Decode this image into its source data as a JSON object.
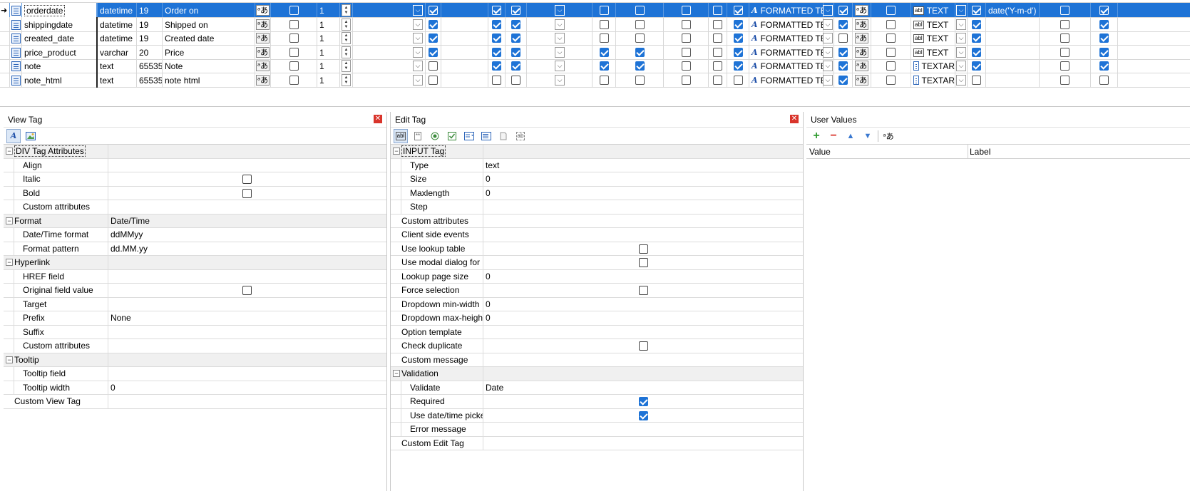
{
  "grid": {
    "rows": [
      {
        "name": "orderdate",
        "type": "datetime",
        "size": "19",
        "caption": "Order on",
        "sort": "1",
        "c1": true,
        "c2": true,
        "c3": true,
        "c4": false,
        "c5": false,
        "c6": false,
        "c7": false,
        "c8": true,
        "edit_tag": "FORMATTED TE",
        "c9": true,
        "c10": false,
        "view_tag": "TEXT",
        "c11": true,
        "default": "date('Y-m-d')",
        "c12": false,
        "c13": true,
        "selected": true
      },
      {
        "name": "shippingdate",
        "type": "datetime",
        "size": "19",
        "caption": "Shipped on",
        "sort": "1",
        "c1": true,
        "c2": true,
        "c3": true,
        "c4": false,
        "c5": false,
        "c6": false,
        "c7": false,
        "c8": true,
        "edit_tag": "FORMATTED TE",
        "c9": true,
        "c10": false,
        "view_tag": "TEXT",
        "c11": true,
        "default": "",
        "c12": false,
        "c13": true,
        "selected": false
      },
      {
        "name": "created_date",
        "type": "datetime",
        "size": "19",
        "caption": "Created date",
        "sort": "1",
        "c1": true,
        "c2": true,
        "c3": true,
        "c4": false,
        "c5": false,
        "c6": false,
        "c7": false,
        "c8": true,
        "edit_tag": "FORMATTED TE",
        "c9": false,
        "c10": false,
        "view_tag": "TEXT",
        "c11": true,
        "default": "",
        "c12": false,
        "c13": true,
        "selected": false
      },
      {
        "name": "price_product",
        "type": "varchar",
        "size": "20",
        "caption": "Price",
        "sort": "1",
        "c1": true,
        "c2": true,
        "c3": true,
        "c4": true,
        "c5": true,
        "c6": false,
        "c7": false,
        "c8": true,
        "edit_tag": "FORMATTED TE",
        "c9": true,
        "c10": false,
        "view_tag": "TEXT",
        "c11": true,
        "default": "",
        "c12": false,
        "c13": true,
        "selected": false
      },
      {
        "name": "note",
        "type": "text",
        "size": "65535",
        "caption": "Note",
        "sort": "1",
        "c1": false,
        "c2": true,
        "c3": true,
        "c4": true,
        "c5": true,
        "c6": false,
        "c7": false,
        "c8": true,
        "edit_tag": "FORMATTED TE",
        "c9": true,
        "c10": false,
        "view_tag": "TEXTAR",
        "c11": true,
        "default": "",
        "c12": false,
        "c13": true,
        "selected": false
      },
      {
        "name": "note_html",
        "type": "text",
        "size": "65535",
        "caption": "note html",
        "sort": "1",
        "c1": false,
        "c2": false,
        "c3": false,
        "c4": false,
        "c5": false,
        "c6": false,
        "c7": false,
        "c8": false,
        "edit_tag": "FORMATTED TE",
        "c9": true,
        "c10": false,
        "view_tag": "TEXTAR",
        "c11": false,
        "default": "",
        "c12": false,
        "c13": false,
        "selected": false
      }
    ]
  },
  "view_tag_panel": {
    "title": "View Tag",
    "rows": [
      {
        "kind": "cat",
        "name": "DIV Tag Attributes",
        "value": "",
        "focus": true
      },
      {
        "kind": "prop",
        "name": "Align",
        "value": ""
      },
      {
        "kind": "prop",
        "name": "Italic",
        "value": "",
        "check": false
      },
      {
        "kind": "prop",
        "name": "Bold",
        "value": "",
        "check": false
      },
      {
        "kind": "prop",
        "name": "Custom attributes",
        "value": ""
      },
      {
        "kind": "cat",
        "name": "Format",
        "value": "Date/Time"
      },
      {
        "kind": "prop",
        "name": "Date/Time format",
        "value": "ddMMyy"
      },
      {
        "kind": "prop",
        "name": "Format pattern",
        "value": "dd.MM.yy"
      },
      {
        "kind": "cat",
        "name": "Hyperlink",
        "value": ""
      },
      {
        "kind": "prop",
        "name": "HREF field",
        "value": ""
      },
      {
        "kind": "prop",
        "name": "Original field value",
        "value": "",
        "check": false
      },
      {
        "kind": "prop",
        "name": "Target",
        "value": ""
      },
      {
        "kind": "prop",
        "name": "Prefix",
        "value": "None"
      },
      {
        "kind": "prop",
        "name": "Suffix",
        "value": ""
      },
      {
        "kind": "prop",
        "name": "Custom attributes",
        "value": ""
      },
      {
        "kind": "cat",
        "name": "Tooltip",
        "value": ""
      },
      {
        "kind": "prop",
        "name": "Tooltip field",
        "value": ""
      },
      {
        "kind": "prop",
        "name": "Tooltip width",
        "value": "0"
      },
      {
        "kind": "top",
        "name": "Custom View Tag",
        "value": ""
      }
    ]
  },
  "edit_tag_panel": {
    "title": "Edit Tag",
    "rows": [
      {
        "kind": "cat",
        "name": "INPUT Tag",
        "value": "",
        "focus": true
      },
      {
        "kind": "prop",
        "name": "Type",
        "value": "text"
      },
      {
        "kind": "prop",
        "name": "Size",
        "value": "0"
      },
      {
        "kind": "prop",
        "name": "Maxlength",
        "value": "0"
      },
      {
        "kind": "prop",
        "name": "Step",
        "value": ""
      },
      {
        "kind": "top",
        "name": "Custom attributes",
        "value": ""
      },
      {
        "kind": "top",
        "name": "Client side events",
        "value": ""
      },
      {
        "kind": "top",
        "name": "Use lookup table",
        "value": "",
        "check": false
      },
      {
        "kind": "top",
        "name": "Use modal dialog for l",
        "value": "",
        "check": false
      },
      {
        "kind": "top",
        "name": "Lookup page size",
        "value": "0"
      },
      {
        "kind": "top",
        "name": "Force selection",
        "value": "",
        "check": false
      },
      {
        "kind": "top",
        "name": "Dropdown min-width",
        "value": "0"
      },
      {
        "kind": "top",
        "name": "Dropdown max-heigh",
        "value": "0"
      },
      {
        "kind": "top",
        "name": "Option template",
        "value": ""
      },
      {
        "kind": "top",
        "name": "Check duplicate",
        "value": "",
        "check": false
      },
      {
        "kind": "top",
        "name": "Custom message",
        "value": ""
      },
      {
        "kind": "cat",
        "name": "Validation",
        "value": ""
      },
      {
        "kind": "prop",
        "name": "Validate",
        "value": "Date"
      },
      {
        "kind": "prop",
        "name": "Required",
        "value": "",
        "check": true
      },
      {
        "kind": "prop",
        "name": "Use date/time picke",
        "value": "",
        "check": true
      },
      {
        "kind": "prop",
        "name": "Error message",
        "value": ""
      },
      {
        "kind": "top",
        "name": "Custom Edit Tag",
        "value": ""
      }
    ]
  },
  "user_values_panel": {
    "title": "User Values",
    "col_value": "Value",
    "col_label": "Label"
  },
  "colors": {
    "selection": "#1e73d6",
    "close": "#d9342b"
  }
}
